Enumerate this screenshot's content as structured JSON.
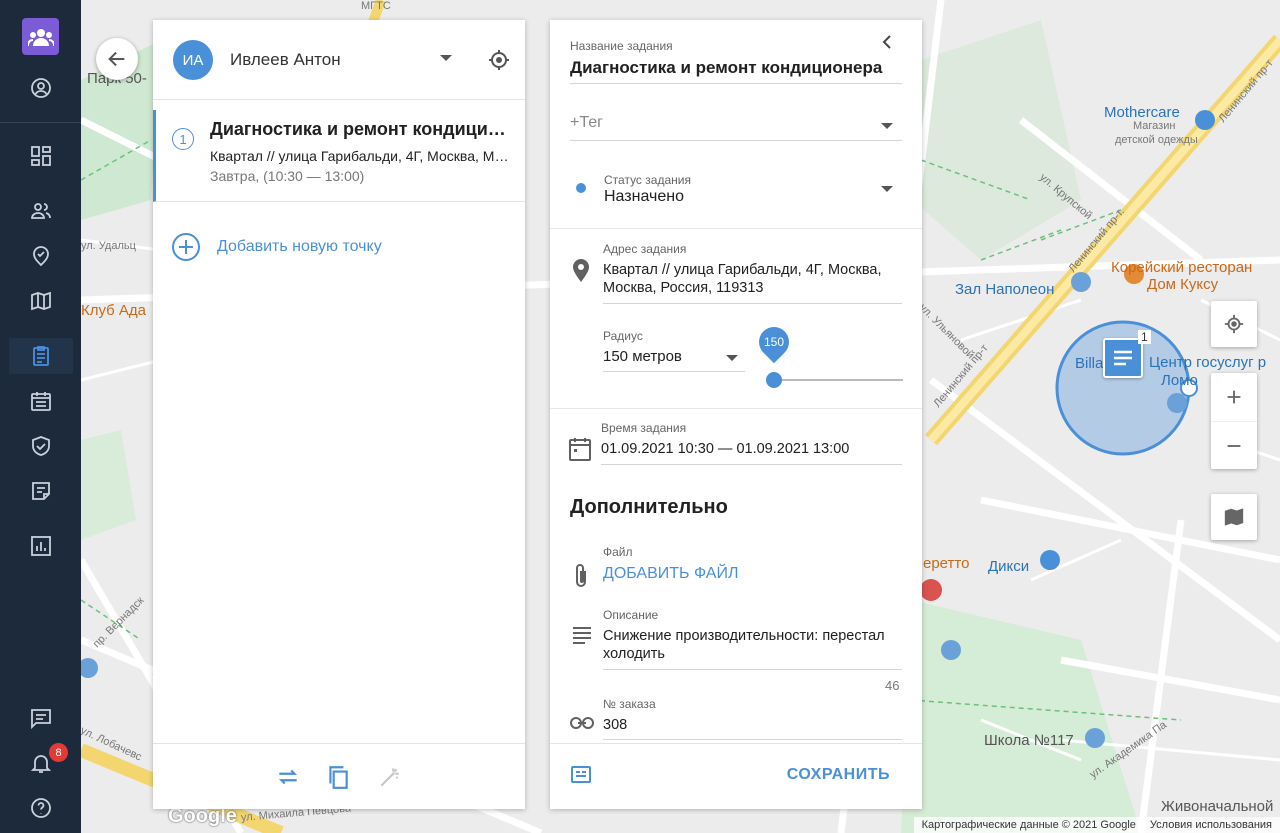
{
  "sidebar": {
    "notifications_count": "8",
    "items": [
      "profile-icon",
      "dashboard-icon",
      "employees-icon",
      "tasks-icon",
      "map-icon",
      "orders-icon",
      "calendar-icon",
      "checklists-icon",
      "forms-icon",
      "reports-icon",
      "chat-icon",
      "bell-icon",
      "help-icon"
    ],
    "active_item": "orders-icon"
  },
  "map": {
    "labels": {
      "park": "Парк 50-",
      "club": "Клуб Ада",
      "mothercare": "Mothercare",
      "mothercare_sub1": "Магазин",
      "mothercare_sub2": "детской одежды",
      "korean": "Корейский ресторан",
      "korean2": "Дом Куксу",
      "napoleon": "Зал Наполеон",
      "gosuslugi": "Центр госуслуг р",
      "gosuslugi2": "Ломо",
      "billa": "Billa",
      "leninsky1": "Ленинский пр-т",
      "leninsky2": "Ленинский пр-т.",
      "leninsky3": "Ленинский пр-т",
      "dixy": "Дикси",
      "eretto": "еретто",
      "school": "Школа №117",
      "zhivonach": "Живоначальной",
      "vernadsky": "пр. Вернадск",
      "lobachev": "ул. Лобачевс",
      "pevtsova": "ул. Михаила Певцова",
      "mgts": "МГТС",
      "udalts": "ул. Удальц",
      "krupskoy": "ул. Крупской",
      "ulyanovoy": "ул. Ульяновой",
      "akademika": "ул. Академика Па"
    },
    "marker_count": "1",
    "google": "Google",
    "attribution": "Картографические данные © 2021 Google",
    "terms": "Условия использования"
  },
  "left_panel": {
    "avatar_initials": "ИА",
    "user_name": "Ивлеев Антон",
    "task": {
      "number": "1",
      "title": "Диагностика и ремонт кондиционера",
      "address": "Квартал // улица Гарибальди, 4Г, Москва, Москва, Россия",
      "time": "Завтра, (10:30 — 13:00)"
    },
    "add_point": "Добавить новую точку"
  },
  "right_panel": {
    "task_name_label": "Название задания",
    "task_name": "Диагностика и ремонт кондиционера",
    "tag_placeholder": "+Тег",
    "status_label": "Статус задания",
    "status_value": "Назначено",
    "status_color": "#4a90d9",
    "address_label": "Адрес задания",
    "address_value": "Квартал // улица Гарибальди, 4Г, Москва, Москва, Россия, 119313",
    "radius_label": "Радиус",
    "radius_value": "150 метров",
    "radius_slider_value": "150",
    "radius_fraction": 0.0,
    "time_label": "Время задания",
    "time_value": "01.09.2021 10:30 — 01.09.2021 13:00",
    "section_title": "Дополнительно",
    "file_label": "Файл",
    "add_file": "ДОБАВИТЬ ФАЙЛ",
    "description_label": "Описание",
    "description_value": "Снижение производительности: перестал холодить",
    "description_count": "46",
    "order_label": "№ заказа",
    "order_value": "308",
    "save": "СОХРАНИТЬ"
  },
  "colors": {
    "accent": "#4a90d9",
    "sidebar_bg": "#1c2a3b",
    "logo_bg": "#7b5cd6",
    "badge": "#e53935"
  }
}
